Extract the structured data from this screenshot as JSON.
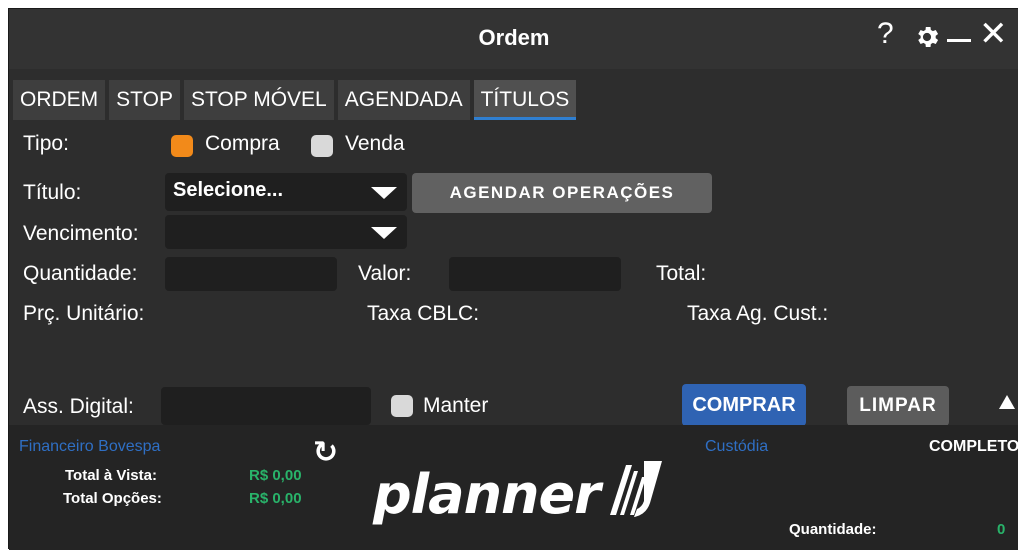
{
  "window": {
    "title": "Ordem"
  },
  "titlebar_icons": {
    "help": "?",
    "close": "✕"
  },
  "tabs": [
    {
      "label": "ORDEM",
      "active": false
    },
    {
      "label": "STOP",
      "active": false
    },
    {
      "label": "STOP MÓVEL",
      "active": false
    },
    {
      "label": "AGENDADA",
      "active": false
    },
    {
      "label": "TÍTULOS",
      "active": true
    }
  ],
  "form": {
    "tipo_label": "Tipo:",
    "compra_label": "Compra",
    "venda_label": "Venda",
    "selected_tipo": "Compra",
    "titulo_label": "Título:",
    "titulo_value": "Selecione...",
    "agendar_label": "AGENDAR OPERAÇÕES",
    "vencimento_label": "Vencimento:",
    "vencimento_value": "",
    "quantidade_label": "Quantidade:",
    "quantidade_value": "",
    "valor_label": "Valor:",
    "valor_value": "",
    "total_label": "Total:",
    "prc_unitario_label": "Prç. Unitário:",
    "taxa_cblc_label": "Taxa CBLC:",
    "taxa_ag_cust_label": "Taxa Ag. Cust.:",
    "ass_digital_label": "Ass. Digital:",
    "ass_digital_value": "",
    "manter_label": "Manter",
    "comprar_label": "COMPRAR",
    "limpar_label": "LIMPAR"
  },
  "footer": {
    "financeiro_title": "Financeiro Bovespa",
    "total_vista_label": "Total à Vista:",
    "total_vista_value": "R$ 0,00",
    "total_opcoes_label": "Total Opções:",
    "total_opcoes_value": "R$ 0,00",
    "logo_text": "planner",
    "custodia_title": "Custódia",
    "completo_label": "COMPLETO",
    "quantidade_label": "Quantidade:",
    "quantidade_value": "0"
  },
  "colors": {
    "accent_orange": "#f28a1a",
    "primary_blue": "#2f63b3",
    "positive_green": "#29b36a",
    "link_blue": "#2f6fc4"
  }
}
